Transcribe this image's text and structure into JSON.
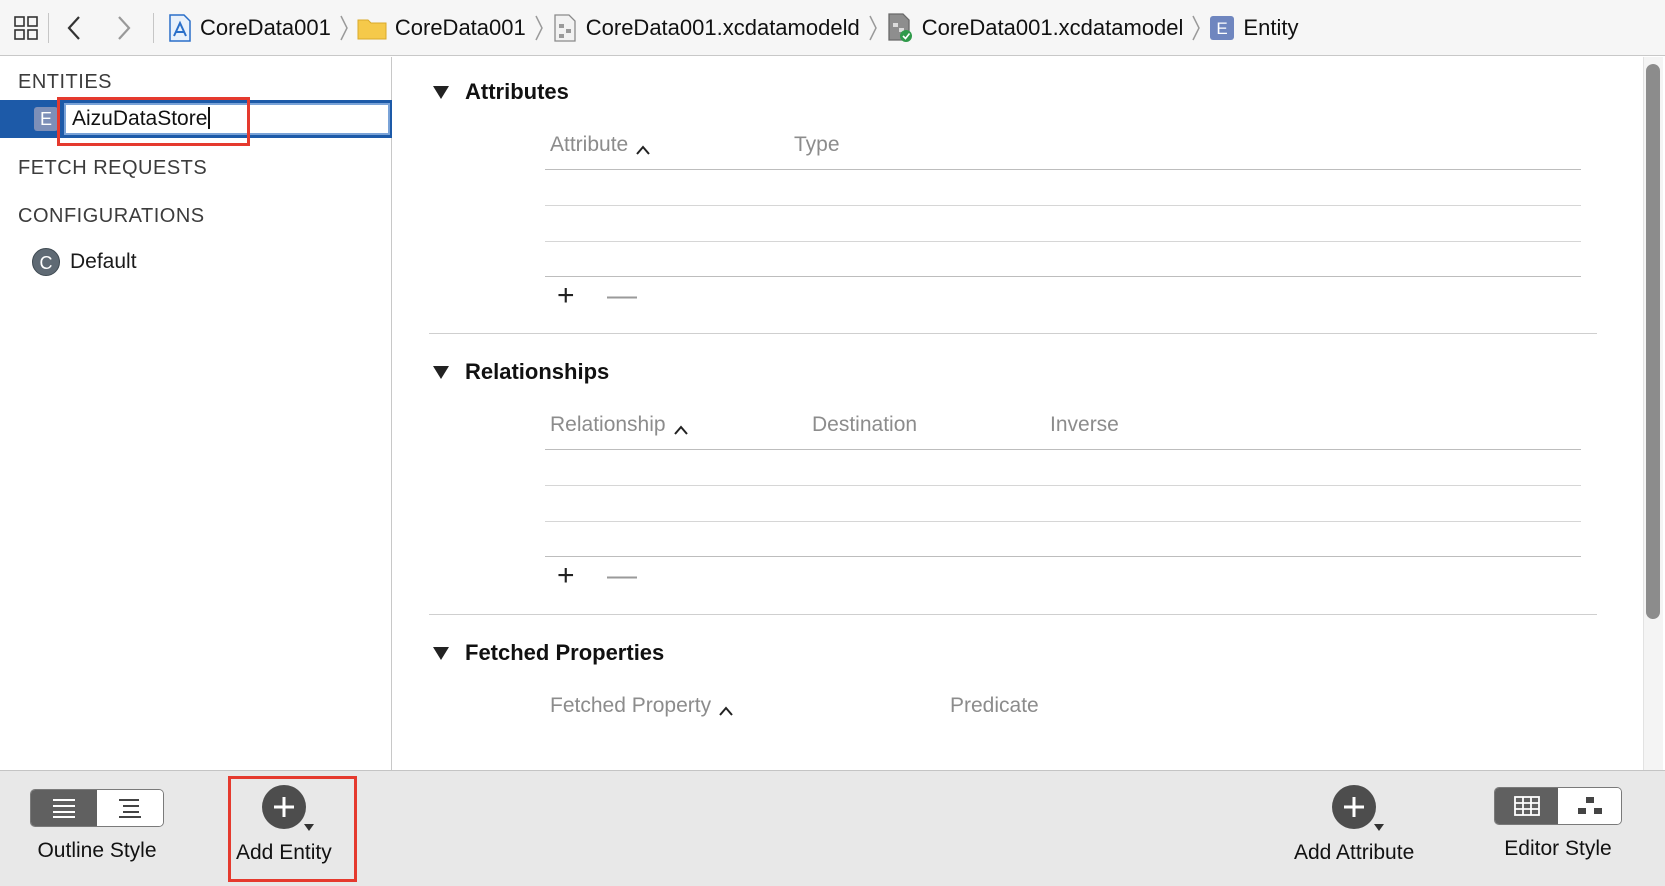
{
  "jumpbar": {
    "crumbs": [
      {
        "label": "CoreData001",
        "icon": "project-icon"
      },
      {
        "label": "CoreData001",
        "icon": "folder-icon"
      },
      {
        "label": "CoreData001.xcdatamodeld",
        "icon": "datamodel-bundle-icon"
      },
      {
        "label": "CoreData001.xcdatamodel",
        "icon": "datamodel-version-icon"
      },
      {
        "label": "Entity",
        "icon": "entity-icon"
      }
    ]
  },
  "sidebar": {
    "entities_header": "ENTITIES",
    "entity_badge": "E",
    "entity_name": "AizuDataStore",
    "fetch_requests_header": "FETCH REQUESTS",
    "configurations_header": "CONFIGURATIONS",
    "config_badge": "C",
    "config_default": "Default"
  },
  "main": {
    "attributes": {
      "title": "Attributes",
      "col_attribute": "Attribute",
      "col_type": "Type"
    },
    "relationships": {
      "title": "Relationships",
      "col_relationship": "Relationship",
      "col_destination": "Destination",
      "col_inverse": "Inverse"
    },
    "fetched_properties": {
      "title": "Fetched Properties",
      "col_fetched_property": "Fetched Property",
      "col_predicate": "Predicate"
    },
    "plus": "+",
    "minus": "—"
  },
  "bottombar": {
    "outline_style_label": "Outline Style",
    "add_entity_label": "Add Entity",
    "add_attribute_label": "Add Attribute",
    "editor_style_label": "Editor Style"
  },
  "colors": {
    "selection": "#1d5aa8",
    "highlight": "#e53a2e"
  }
}
